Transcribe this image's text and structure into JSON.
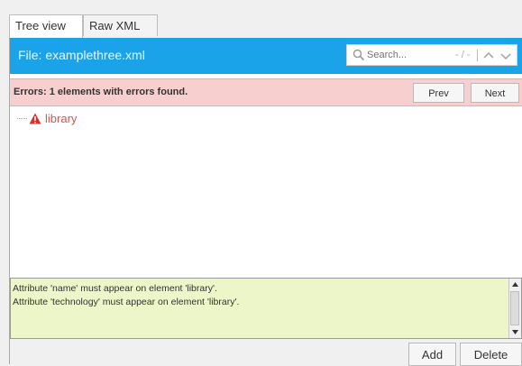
{
  "tabs": [
    {
      "label": "Tree view",
      "active": true
    },
    {
      "label": "Raw XML",
      "active": false
    }
  ],
  "header": {
    "file_label": "File: examplethree.xml",
    "bg_color": "#1aa3e8"
  },
  "search": {
    "placeholder": "Search...",
    "count": "- / -",
    "icon": "search-icon",
    "up_icon": "chevron-up-icon",
    "down_icon": "chevron-down-icon"
  },
  "errors": {
    "summary": "Errors: 1 elements with errors found.",
    "prev_label": "Prev",
    "next_label": "Next",
    "bg_color": "#f8cfcf"
  },
  "tree": {
    "nodes": [
      {
        "label": "library",
        "has_error": true,
        "icon": "warning-icon"
      }
    ],
    "error_color": "#d9534f"
  },
  "messages": {
    "lines": [
      "Attribute 'name' must appear on element 'library'.",
      "Attribute 'technology' must appear on element 'library'."
    ],
    "bg_color": "#ecf6c8"
  },
  "actions": {
    "add_label": "Add",
    "delete_label": "Delete"
  }
}
